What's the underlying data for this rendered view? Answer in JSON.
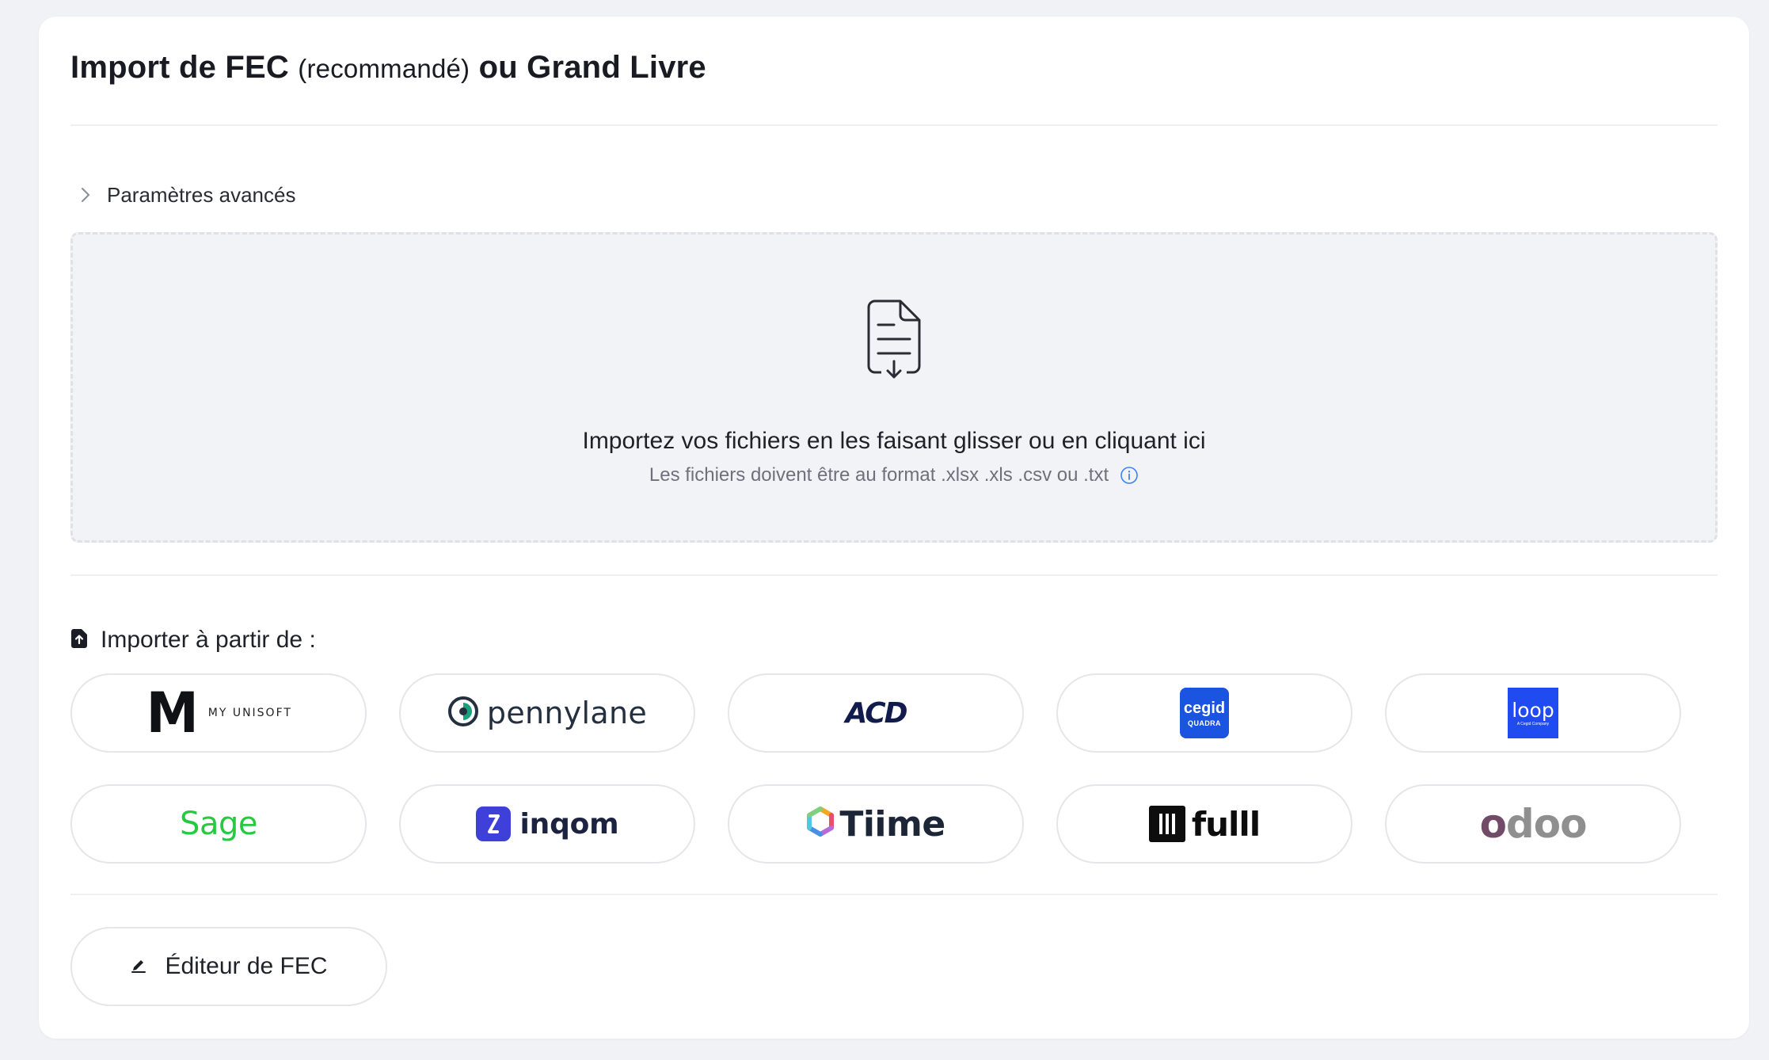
{
  "header": {
    "title_main": "Import de FEC",
    "title_small": "(recommandé)",
    "title_end": "ou Grand Livre"
  },
  "advanced": {
    "label": "Paramètres avancés",
    "icon": "chevron-right-icon"
  },
  "dropzone": {
    "icon": "document-download-icon",
    "text": "Importez vos fichiers en les faisant glisser ou en cliquant ici",
    "subtext": "Les fichiers doivent être au format .xlsx .xls .csv ou .txt",
    "info_icon": "info-icon"
  },
  "import_from": {
    "icon": "file-upload-icon",
    "label": "Importer à partir de :"
  },
  "integrations": [
    {
      "id": "myunisoft",
      "logo_mark": "M",
      "logo_text": "MY UNISOFT"
    },
    {
      "id": "pennylane",
      "logo_text": "pennylane"
    },
    {
      "id": "acd",
      "logo_text": "ACD"
    },
    {
      "id": "cegid",
      "logo_text": "cegid",
      "logo_subtext": "QUADRA",
      "color": "#1b54e0"
    },
    {
      "id": "loop",
      "logo_text": "loop",
      "logo_subtext": "A Cegid Company",
      "color": "#1f4bf0"
    },
    {
      "id": "sage",
      "logo_text": "Sage",
      "color": "#27c941"
    },
    {
      "id": "inqom",
      "logo_text": "inqom",
      "color": "#3f3fd9"
    },
    {
      "id": "tiime",
      "logo_text": "Tiime"
    },
    {
      "id": "fulll",
      "logo_text": "fulll"
    },
    {
      "id": "odoo",
      "logo_text_1": "o",
      "logo_text_2": "doo",
      "color": "#714b67"
    }
  ],
  "editor": {
    "label": "Éditeur de FEC",
    "icon": "pen-icon"
  }
}
